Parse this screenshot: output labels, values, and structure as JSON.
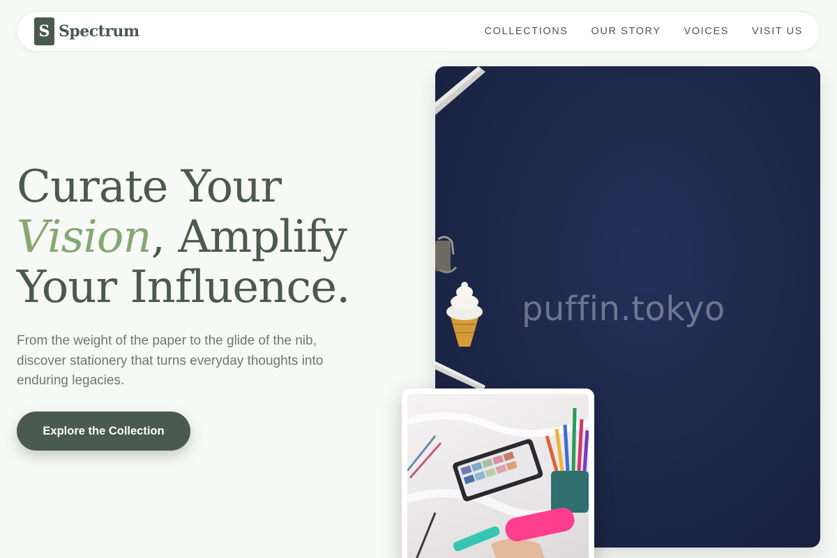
{
  "nav": {
    "brand_mark": "S",
    "brand_name": "Spectrum",
    "links": [
      {
        "label": "COLLECTIONS"
      },
      {
        "label": "OUR STORY"
      },
      {
        "label": "VOICES"
      },
      {
        "label": "VISIT US"
      }
    ]
  },
  "hero": {
    "title_line1": "Curate Your",
    "title_accent": "Vision",
    "title_line2_rest": ", Amplify",
    "title_line3": "Your Influence.",
    "subtitle": "From the weight of the paper to the glide of the nib, discover stationery that turns everyday thoughts into enduring legacies.",
    "cta_label": "Explore the Collection"
  },
  "images": {
    "main_watermark": "puffin.tokyo",
    "main_icon": "ice-cream-eraser-on-navy-desk",
    "thumb_icon": "watercolor-and-markers"
  },
  "colors": {
    "primary": "#4a5a4c",
    "accent": "#86a873",
    "background": "#f7f9f7",
    "navy": "#1c2748"
  }
}
